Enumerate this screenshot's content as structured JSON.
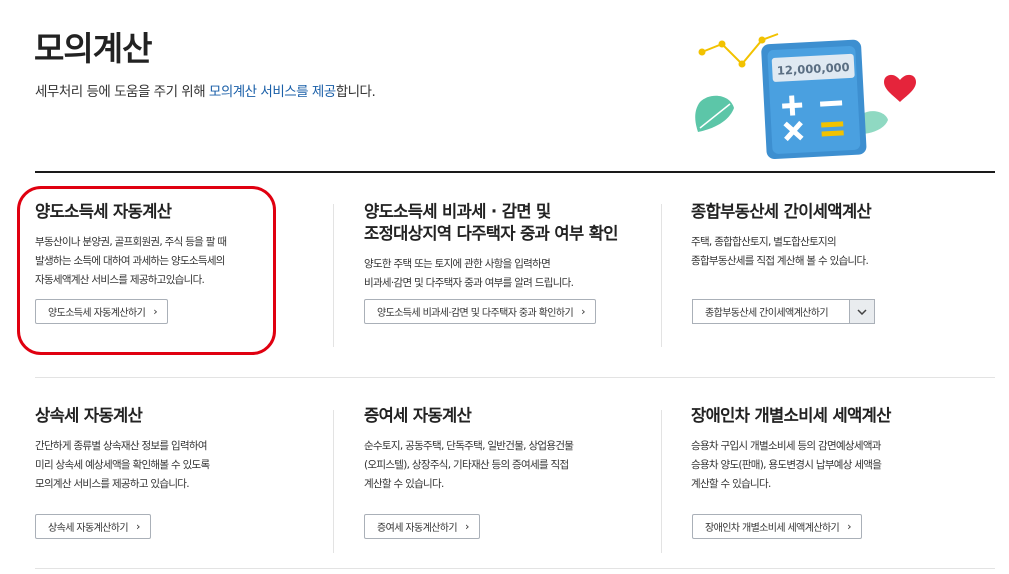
{
  "header": {
    "title": "모의계산",
    "desc_prefix": "세무처리 등에 도움을 주기 위해 ",
    "desc_highlight": "모의계산 서비스를 제공",
    "desc_suffix": "합니다."
  },
  "hero": {
    "calculator_display": "12,000,000"
  },
  "cards": [
    {
      "title": "양도소득세 자동계산",
      "desc": "부동산이나 분양권, 골프회원권, 주식 등을 팔 때\n발생하는 소득에 대하여 과세하는 양도소득세의\n자동세액계산 서비스를 제공하고있습니다.",
      "button": "양도소득세 자동계산하기"
    },
    {
      "title": "양도소득세 비과세 · 감면 및",
      "title2": "조정대상지역 다주택자 중과 여부 확인",
      "desc": "양도한 주택 또는 토지에 관한 사항을 입력하면\n비과세·감면 및 다주택자 중과 여부를 알려 드립니다.",
      "button": "양도소득세 비과세·감면 및 다주택자 중과 확인하기"
    },
    {
      "title": "종합부동산세 간이세액계산",
      "desc": "주택, 종합합산토지, 별도합산토지의\n종합부동산세를 직접 계산해 볼 수 있습니다.",
      "select_value": "종합부동산세 간이세액계산하기"
    },
    {
      "title": "상속세 자동계산",
      "desc": "간단하게 종류별 상속재산 정보를 입력하여\n미리 상속세 예상세액을 확인해볼 수 있도록\n모의계산 서비스를 제공하고 있습니다.",
      "button": "상속세 자동계산하기"
    },
    {
      "title": "증여세 자동계산",
      "desc": "순수토지, 공동주택, 단독주택, 일반건물, 상업용건물\n(오피스텔), 상장주식, 기타재산 등의 증여세를 직접\n계산할 수 있습니다.",
      "button": "증여세 자동계산하기"
    },
    {
      "title": "장애인차 개별소비세 세액계산",
      "desc": "승용차 구입시 개별소비세 등의 감면예상세액과\n승용차 양도(판매), 용도변경시 납부예상 세액을\n계산할 수 있습니다.",
      "button": "장애인차 개별소비세 세액계산하기"
    }
  ],
  "colors": {
    "highlight_text": "#1a5fa8",
    "annotation_ring": "#e00010",
    "calculator_body": "#3d8fd0",
    "accent_yellow": "#f2c200",
    "heart": "#e5243b",
    "leaf": "#5cc6a8"
  }
}
